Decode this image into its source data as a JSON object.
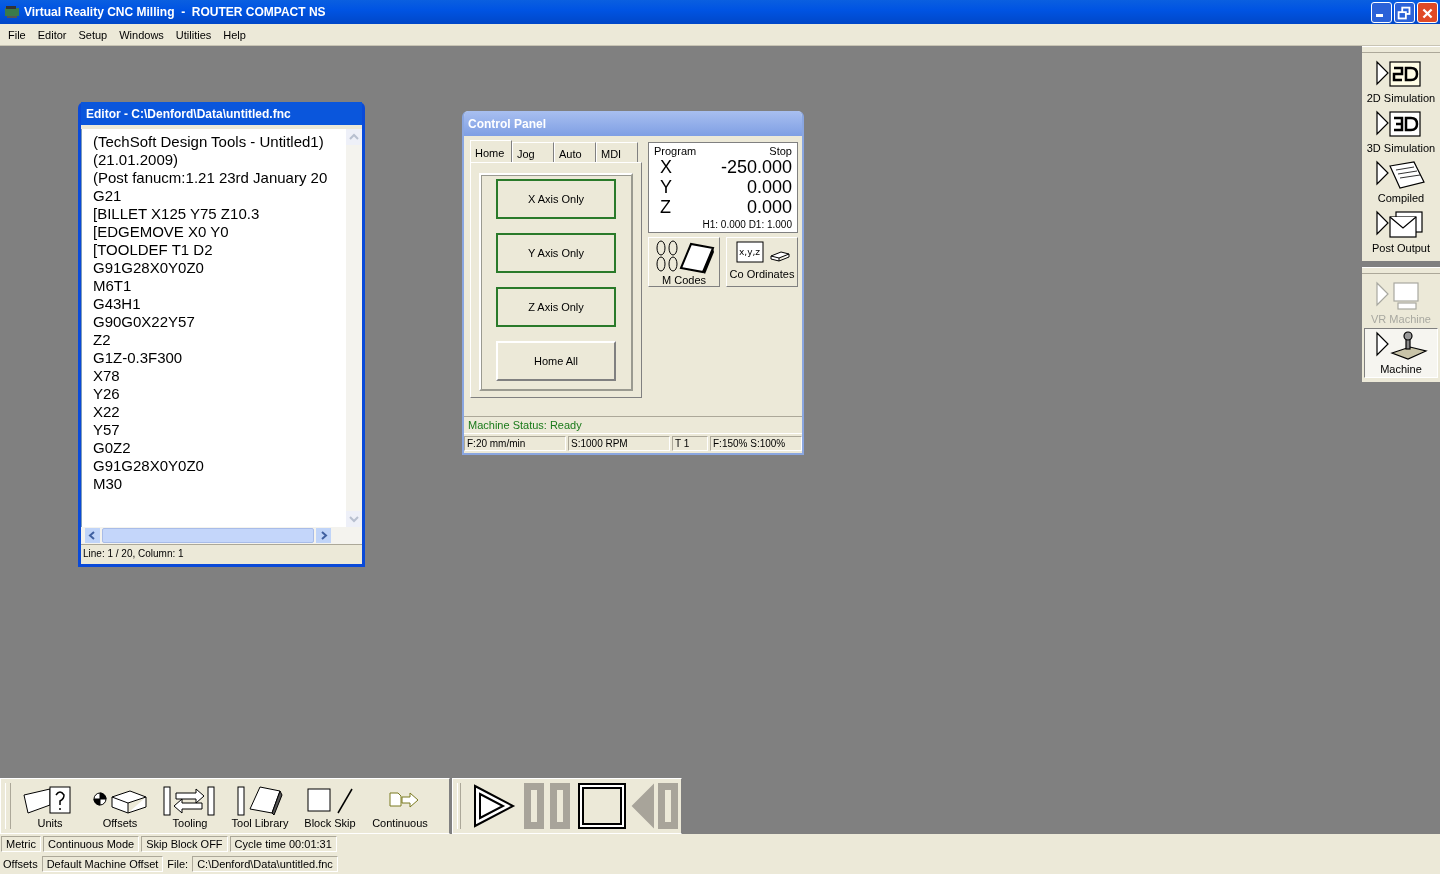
{
  "window": {
    "title": "Virtual Reality CNC Milling  -  ROUTER COMPACT NS"
  },
  "menu": [
    {
      "label": "File"
    },
    {
      "label": "Editor"
    },
    {
      "label": "Setup"
    },
    {
      "label": "Windows"
    },
    {
      "label": "Utilities"
    },
    {
      "label": "Help"
    }
  ],
  "editor": {
    "title": "Editor - C:\\Denford\\Data\\untitled.fnc",
    "lines": [
      "(TechSoft Design Tools - Untitled1)",
      "(21.01.2009)",
      "(Post fanucm:1.21 23rd January 20",
      "G21",
      "[BILLET X125 Y75 Z10.3",
      "[EDGEMOVE X0 Y0",
      "[TOOLDEF T1 D2",
      "G91G28X0Y0Z0",
      "M6T1",
      "G43H1",
      "G90G0X22Y57",
      "Z2",
      "G1Z-0.3F300",
      "X78",
      "Y26",
      "X22",
      "Y57",
      "G0Z2",
      "G91G28X0Y0Z0",
      "M30"
    ],
    "status": "Line: 1 / 20, Column: 1"
  },
  "control_panel": {
    "title": "Control Panel",
    "tabs": [
      {
        "label": "Home",
        "selected": true
      },
      {
        "label": "Jog",
        "selected": false
      },
      {
        "label": "Auto",
        "selected": false
      },
      {
        "label": "MDI",
        "selected": false
      }
    ],
    "home_buttons": [
      {
        "label": "X Axis Only",
        "highlighted": true
      },
      {
        "label": "Y Axis Only",
        "highlighted": true
      },
      {
        "label": "Z Axis Only",
        "highlighted": true
      },
      {
        "label": "Home All",
        "highlighted": false
      }
    ],
    "readout": {
      "mode": "Program",
      "state": "Stop",
      "axes": [
        {
          "axis": "X",
          "value": "-250.000"
        },
        {
          "axis": "Y",
          "value": "0.000"
        },
        {
          "axis": "Z",
          "value": "0.000"
        }
      ],
      "offsets": "H1: 0.000  D1: 1.000"
    },
    "tools": [
      {
        "label": "M Codes",
        "kind": "mcodes"
      },
      {
        "label": "Co Ordinates",
        "kind": "coords",
        "icon_text": "x,y,z"
      }
    ],
    "machine_status": "Machine Status: Ready",
    "status_cells": [
      "F:20 mm/min",
      "S:1000 RPM",
      "T 1",
      "F:150% S:100%"
    ]
  },
  "side_toolbar": [
    [
      {
        "label": "2D Simulation",
        "kind": "sim2d",
        "disabled": false
      },
      {
        "label": "3D Simulation",
        "kind": "sim3d",
        "disabled": false
      },
      {
        "label": "Compiled",
        "kind": "compiled",
        "disabled": false
      },
      {
        "label": "Post Output",
        "kind": "post",
        "disabled": false
      }
    ],
    [
      {
        "label": "VR Machine",
        "kind": "vr",
        "disabled": true
      },
      {
        "label": "Machine",
        "kind": "machine",
        "disabled": false
      }
    ]
  ],
  "bottom_toolbar": [
    {
      "label": "Units",
      "kind": "units"
    },
    {
      "label": "Offsets",
      "kind": "offsets"
    },
    {
      "label": "Tooling",
      "kind": "tooling"
    },
    {
      "label": "Tool Library",
      "kind": "library"
    },
    {
      "label": "Block Skip",
      "kind": "blockskip"
    },
    {
      "label": "Continuous",
      "kind": "continuous"
    }
  ],
  "playback": [
    {
      "kind": "play",
      "disabled": false
    },
    {
      "kind": "pause",
      "disabled": true
    },
    {
      "kind": "stop",
      "disabled": false
    },
    {
      "kind": "rewind",
      "disabled": true
    }
  ],
  "status_rows": [
    [
      "Metric",
      "Continuous Mode",
      "Skip Block OFF",
      "Cycle time 00:01:31"
    ],
    [
      "Offsets",
      "Default Machine Offset",
      "File:",
      "C:\\Denford\\Data\\untitled.fnc"
    ]
  ]
}
